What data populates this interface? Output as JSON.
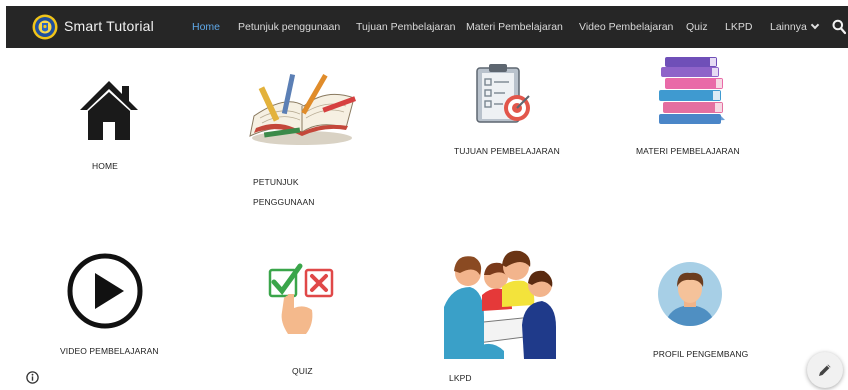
{
  "header": {
    "site_title": "Smart Tutorial",
    "nav": [
      {
        "label": "Home",
        "active": true
      },
      {
        "label": "Petunjuk penggunaan",
        "active": false
      },
      {
        "label": "Tujuan Pembelajaran",
        "active": false
      },
      {
        "label": "Materi Pembelajaran",
        "active": false
      },
      {
        "label": "Video Pembelajaran",
        "active": false
      },
      {
        "label": "Quiz",
        "active": false
      },
      {
        "label": "LKPD",
        "active": false
      },
      {
        "label": "Lainnya",
        "active": false,
        "has_dropdown": true
      }
    ],
    "icons": {
      "logo": "university-seal-logo",
      "search": "search-icon",
      "dropdown": "chevron-down-icon"
    }
  },
  "tiles": [
    {
      "label": "HOME",
      "icon": "home-icon"
    },
    {
      "label_line1": "PETUNJUK",
      "label_line2": "PENGGUNAAN",
      "icon": "notebook-pencils-image"
    },
    {
      "label": "TUJUAN PEMBELAJARAN",
      "icon": "checklist-target-image"
    },
    {
      "label": "MATERI PEMBELAJARAN",
      "icon": "book-stack-image"
    },
    {
      "label": "VIDEO PEMBELAJARAN",
      "icon": "play-circle-icon"
    },
    {
      "label": "QUIZ",
      "icon": "check-cross-quiz-image"
    },
    {
      "label": "LKPD",
      "icon": "group-discussion-image"
    },
    {
      "label": "PROFIL PENGEMBANG",
      "icon": "avatar-image"
    }
  ],
  "footer": {
    "info_icon": "info-icon",
    "edit_icon": "edit-pencil-icon"
  },
  "colors": {
    "navbar_bg": "#262626",
    "active_nav": "#5fa8e8",
    "page_bg": "#ffffff"
  }
}
